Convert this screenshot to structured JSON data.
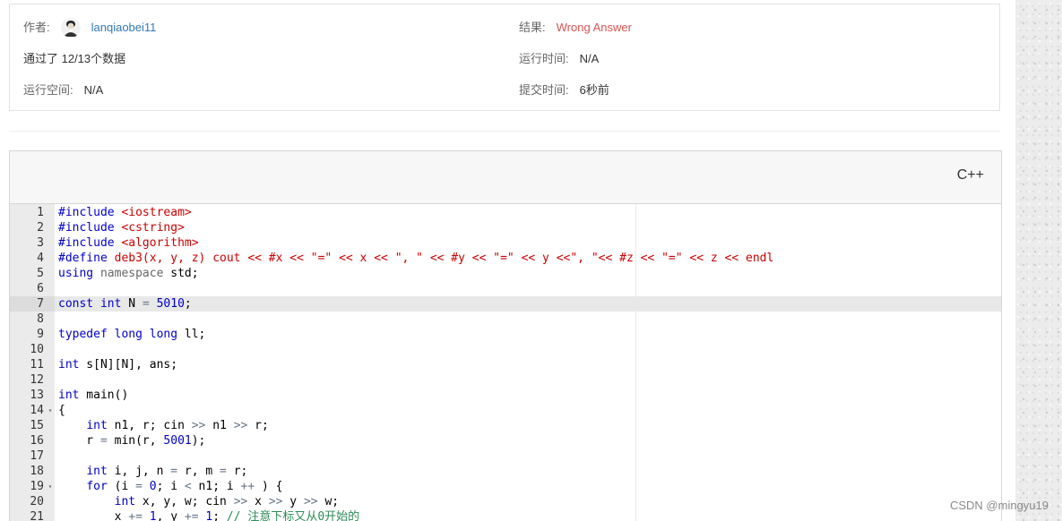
{
  "info": {
    "author_label": "作者:",
    "author_name": "lanqiaobei11",
    "result_label": "结果:",
    "result_value": "Wrong Answer",
    "passed_text": "通过了 12/13个数据",
    "runtime_label": "运行时间:",
    "runtime_value": "N/A",
    "memory_label": "运行空间:",
    "memory_value": "N/A",
    "submit_label": "提交时间:",
    "submit_value": "6秒前"
  },
  "code_panel": {
    "language": "C++"
  },
  "code_lines": [
    {
      "n": "1",
      "fold": "",
      "html": "<span class='pp'>#include</span> <span class='str'>&lt;iostream&gt;</span>"
    },
    {
      "n": "2",
      "fold": "",
      "html": "<span class='pp'>#include</span> <span class='str'>&lt;cstring&gt;</span>"
    },
    {
      "n": "3",
      "fold": "",
      "html": "<span class='pp'>#include</span> <span class='str'>&lt;algorithm&gt;</span>"
    },
    {
      "n": "4",
      "fold": "",
      "html": "<span class='pp'>#define</span> <span class='str'>deb3(x, y, z) cout &lt;&lt; #x &lt;&lt; \"=\" &lt;&lt; x &lt;&lt; \", \" &lt;&lt; #y &lt;&lt; \"=\" &lt;&lt; y &lt;&lt;\", \"&lt;&lt; #z &lt;&lt; \"=\" &lt;&lt; z &lt;&lt; endl</span>"
    },
    {
      "n": "5",
      "fold": "",
      "html": "<span class='kw'>using</span> <span class='ns'>namespace</span> std;"
    },
    {
      "n": "6",
      "fold": "",
      "html": ""
    },
    {
      "n": "7",
      "fold": "",
      "active": true,
      "html": "<span class='kw'>const</span> <span class='kw'>int</span> N <span class='op'>=</span> <span class='num'>5010</span>;"
    },
    {
      "n": "8",
      "fold": "",
      "html": ""
    },
    {
      "n": "9",
      "fold": "",
      "html": "<span class='kw'>typedef</span> <span class='kw'>long</span> <span class='kw'>long</span> ll;"
    },
    {
      "n": "10",
      "fold": "",
      "html": ""
    },
    {
      "n": "11",
      "fold": "",
      "html": "<span class='kw'>int</span> s[N][N], ans;"
    },
    {
      "n": "12",
      "fold": "",
      "html": ""
    },
    {
      "n": "13",
      "fold": "",
      "html": "<span class='kw'>int</span> main()"
    },
    {
      "n": "14",
      "fold": "▾",
      "html": "{"
    },
    {
      "n": "15",
      "fold": "",
      "html": "    <span class='kw'>int</span> n1, r; cin <span class='op'>&gt;&gt;</span> n1 <span class='op'>&gt;&gt;</span> r;"
    },
    {
      "n": "16",
      "fold": "",
      "html": "    r <span class='op'>=</span> min(r, <span class='num'>5001</span>);"
    },
    {
      "n": "17",
      "fold": "",
      "html": ""
    },
    {
      "n": "18",
      "fold": "",
      "html": "    <span class='kw'>int</span> i, j, n <span class='op'>=</span> r, m <span class='op'>=</span> r;"
    },
    {
      "n": "19",
      "fold": "▾",
      "html": "    <span class='kw'>for</span> (i <span class='op'>=</span> <span class='num'>0</span>; i <span class='op'>&lt;</span> n1; i <span class='op'>++</span> ) {"
    },
    {
      "n": "20",
      "fold": "",
      "html": "        <span class='kw'>int</span> x, y, w; cin <span class='op'>&gt;&gt;</span> x <span class='op'>&gt;&gt;</span> y <span class='op'>&gt;&gt;</span> w;"
    },
    {
      "n": "21",
      "fold": "",
      "html": "        x <span class='op'>+=</span> <span class='num'>1</span>, y <span class='op'>+=</span> <span class='num'>1</span>; <span class='cm'>// 注意下标又从0开始的</span>"
    }
  ],
  "watermark": "CSDN @mingyu19",
  "icons": {
    "avatar": "user-avatar-icon",
    "fold": "fold-arrow-icon"
  },
  "colors": {
    "link": "#337ab7",
    "wrong_answer": "#d9534f",
    "keyword": "#0000cc",
    "string": "#cc0000"
  }
}
